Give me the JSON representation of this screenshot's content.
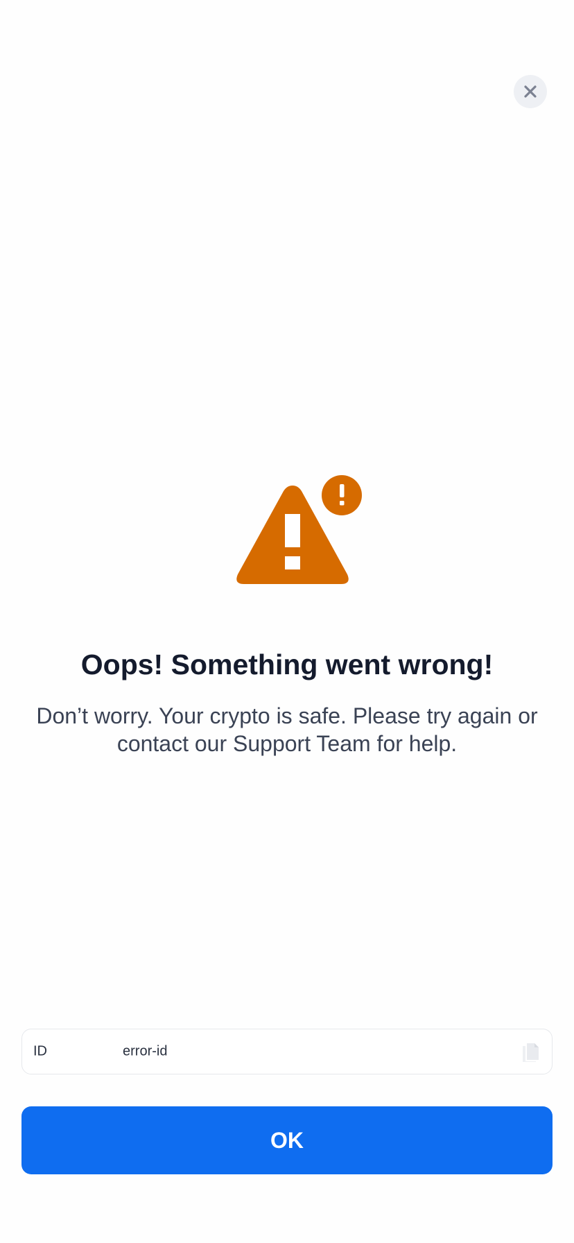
{
  "header": {
    "close_icon": "close-icon"
  },
  "illustration": {
    "icon": "warning-triangle-icon",
    "badge_icon": "exclamation-badge-icon",
    "color": "#d66b00"
  },
  "error": {
    "title": "Oops! Something went wrong!",
    "message": "Don’t worry. Your crypto is safe. Please try again or contact our Support Team for help."
  },
  "id_field": {
    "label": "ID",
    "value": "error-id",
    "copy_icon": "copy-icon"
  },
  "actions": {
    "ok_label": "OK",
    "ok_color": "#0f6df0"
  }
}
